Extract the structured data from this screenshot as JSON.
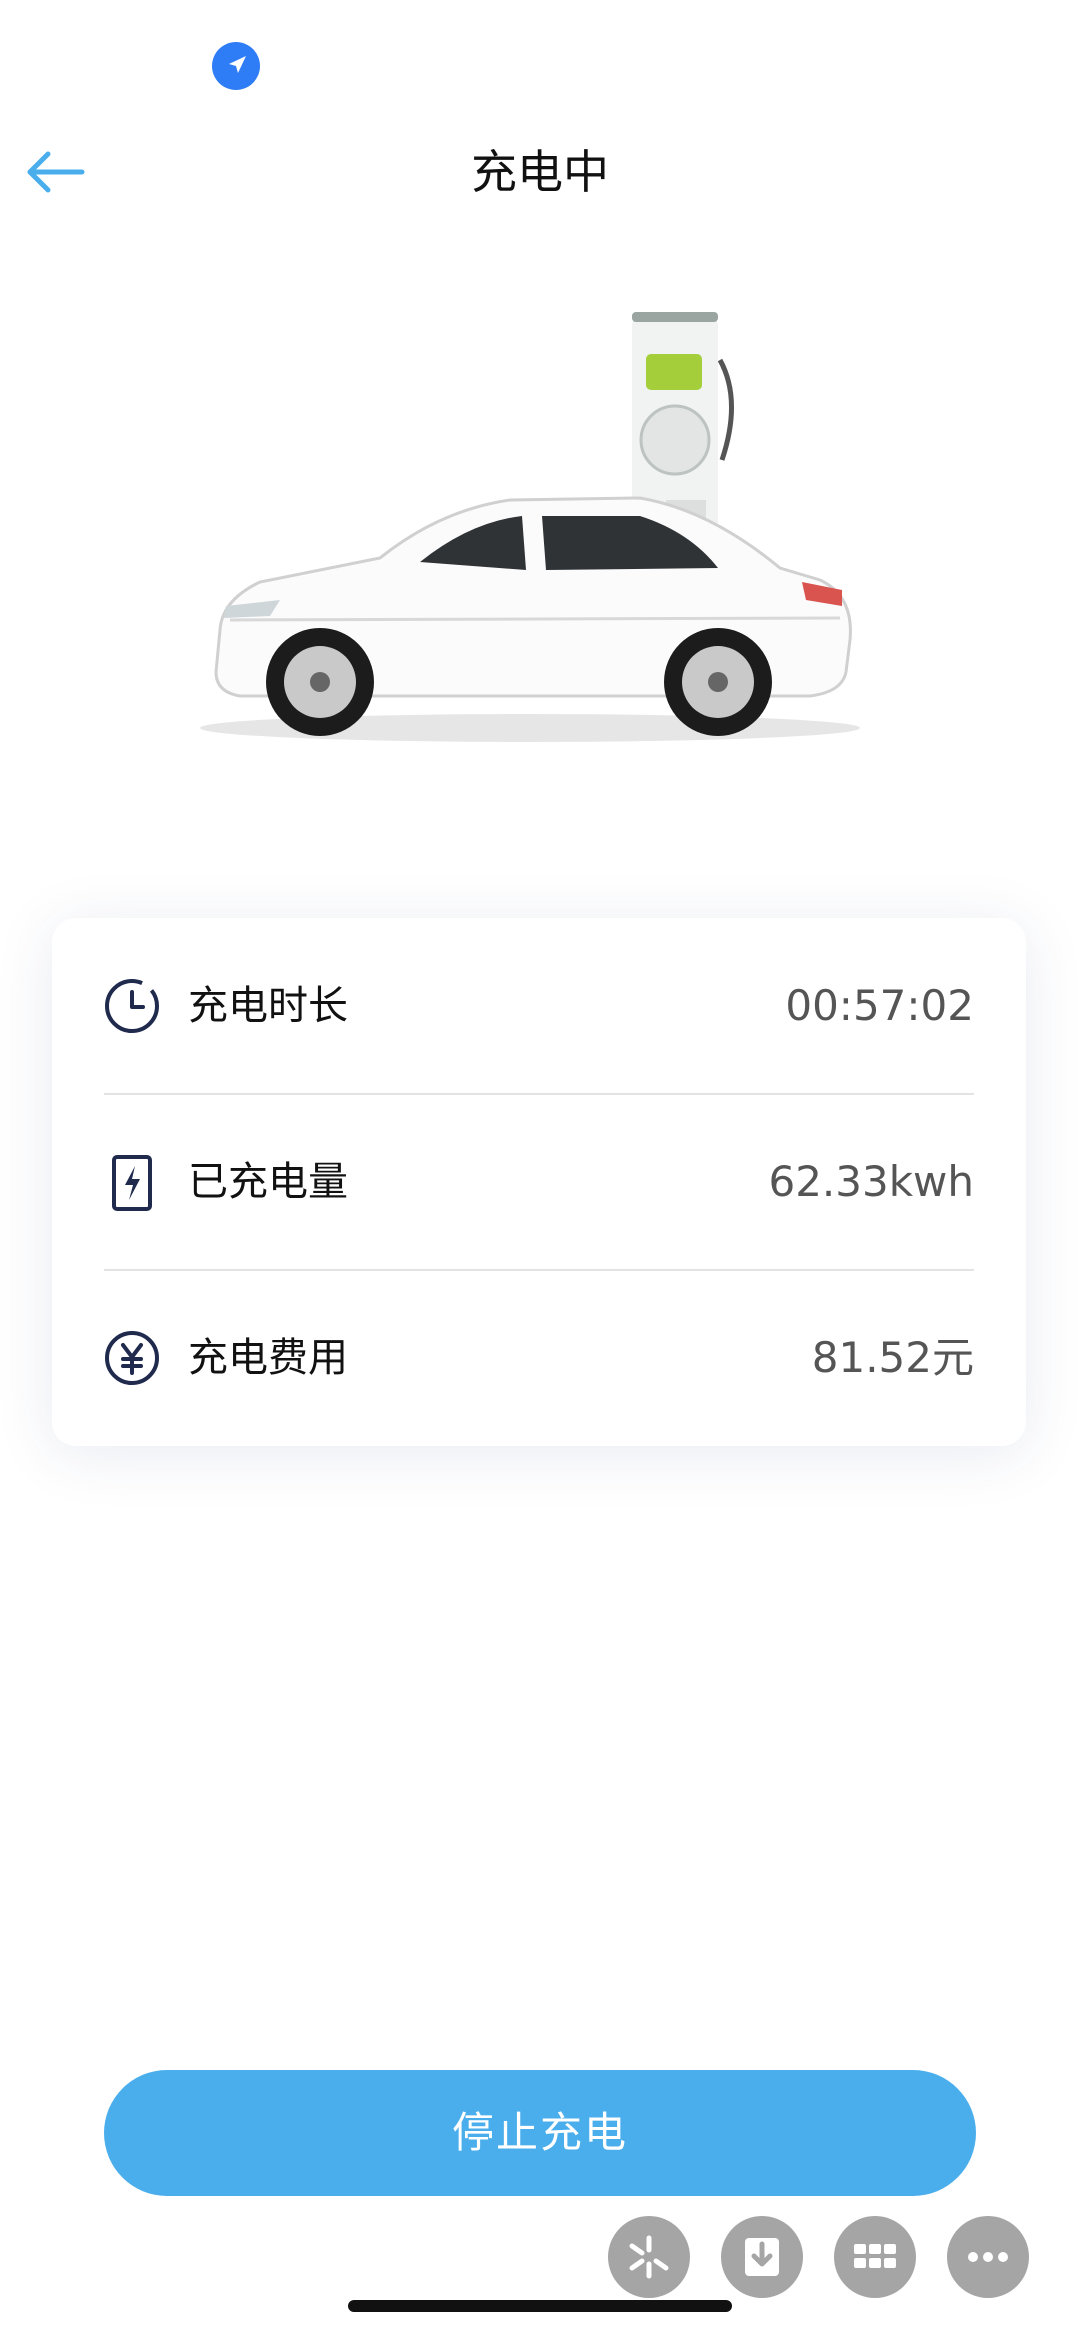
{
  "header": {
    "title": "充电中",
    "back_icon": "arrow-left-icon"
  },
  "status_bar": {
    "location_icon": "location-arrow-icon",
    "accent": "#2f7df6"
  },
  "charging_info": [
    {
      "icon": "clock-icon",
      "label": "充电时长",
      "value": "00:57:02"
    },
    {
      "icon": "battery-bolt-icon",
      "label": "已充电量",
      "value": "62.33kwh"
    },
    {
      "icon": "yen-icon",
      "label": "充电费用",
      "value": "81.52元"
    }
  ],
  "actions": {
    "stop_label": "停止充电",
    "button_color": "#4aaeec"
  },
  "toolbar": {
    "items": [
      "sparkle-icon",
      "download-icon",
      "grid-icon",
      "more-icon"
    ]
  }
}
